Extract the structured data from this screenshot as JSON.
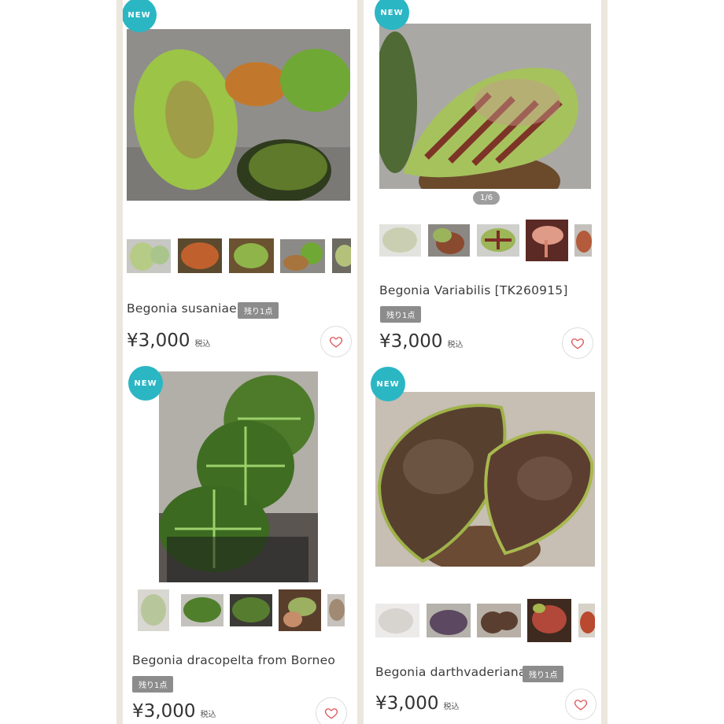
{
  "products": [
    {
      "badge": "NEW",
      "title": "Begonia susaniae",
      "stock": "残り1点",
      "price": "¥3,000",
      "tax": "税込"
    },
    {
      "badge": "NEW",
      "title": "Begonia Variabilis [TK260915]",
      "stock": "残り1点",
      "price": "¥3,000",
      "tax": "税込",
      "counter": "1/6"
    },
    {
      "badge": "NEW",
      "title": "Begonia dracopelta from Borneo",
      "stock": "残り1点",
      "price": "¥3,000",
      "tax": "税込"
    },
    {
      "badge": "NEW",
      "title": "Begonia darthvaderiana",
      "stock": "残り1点",
      "price": "¥3,000",
      "tax": "税込"
    }
  ],
  "icons": {
    "favorite": "heart-icon"
  },
  "colors": {
    "badge": "#2bb6c4",
    "heart": "#e0575b",
    "stock_bg": "#8c8c8c"
  }
}
